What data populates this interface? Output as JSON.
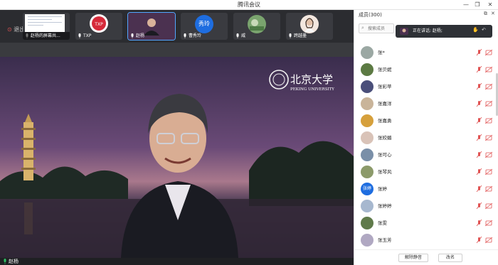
{
  "app": {
    "title": "腾讯会议"
  },
  "toolbar": {
    "leave_label": "退出"
  },
  "thumbnails": [
    {
      "label": "赵杨的屏幕共..."
    },
    {
      "label": "TXP"
    },
    {
      "label": "赵杨"
    },
    {
      "label": "曹秀玲",
      "avatar_text": "秀玲"
    },
    {
      "label": "威"
    },
    {
      "label": "跨越墨"
    }
  ],
  "main_video": {
    "speaker": "赵杨",
    "logo_text": "北京大学",
    "logo_sub": "PEKING UNIVERSITY"
  },
  "members": {
    "title": "成员(300)",
    "search_placeholder": "搜索成员",
    "speaking": "正在讲话: 赵杨;",
    "items": [
      {
        "name": "张*"
      },
      {
        "name": "张贝妮"
      },
      {
        "name": "张彩苹"
      },
      {
        "name": "张嘉洋"
      },
      {
        "name": "张嘉勇"
      },
      {
        "name": "张姣媚"
      },
      {
        "name": "张可心"
      },
      {
        "name": "张琴风"
      },
      {
        "name": "张婷",
        "avatar_text": "张婷"
      },
      {
        "name": "张婷婷"
      },
      {
        "name": "张雯"
      },
      {
        "name": "张玉芳"
      }
    ],
    "unmute_label": "解除静音",
    "rename_label": "改名"
  },
  "colors": {
    "accent": "#52a7ff",
    "mute_red": "#e05252",
    "blue_avatar": "#1e6de0"
  }
}
